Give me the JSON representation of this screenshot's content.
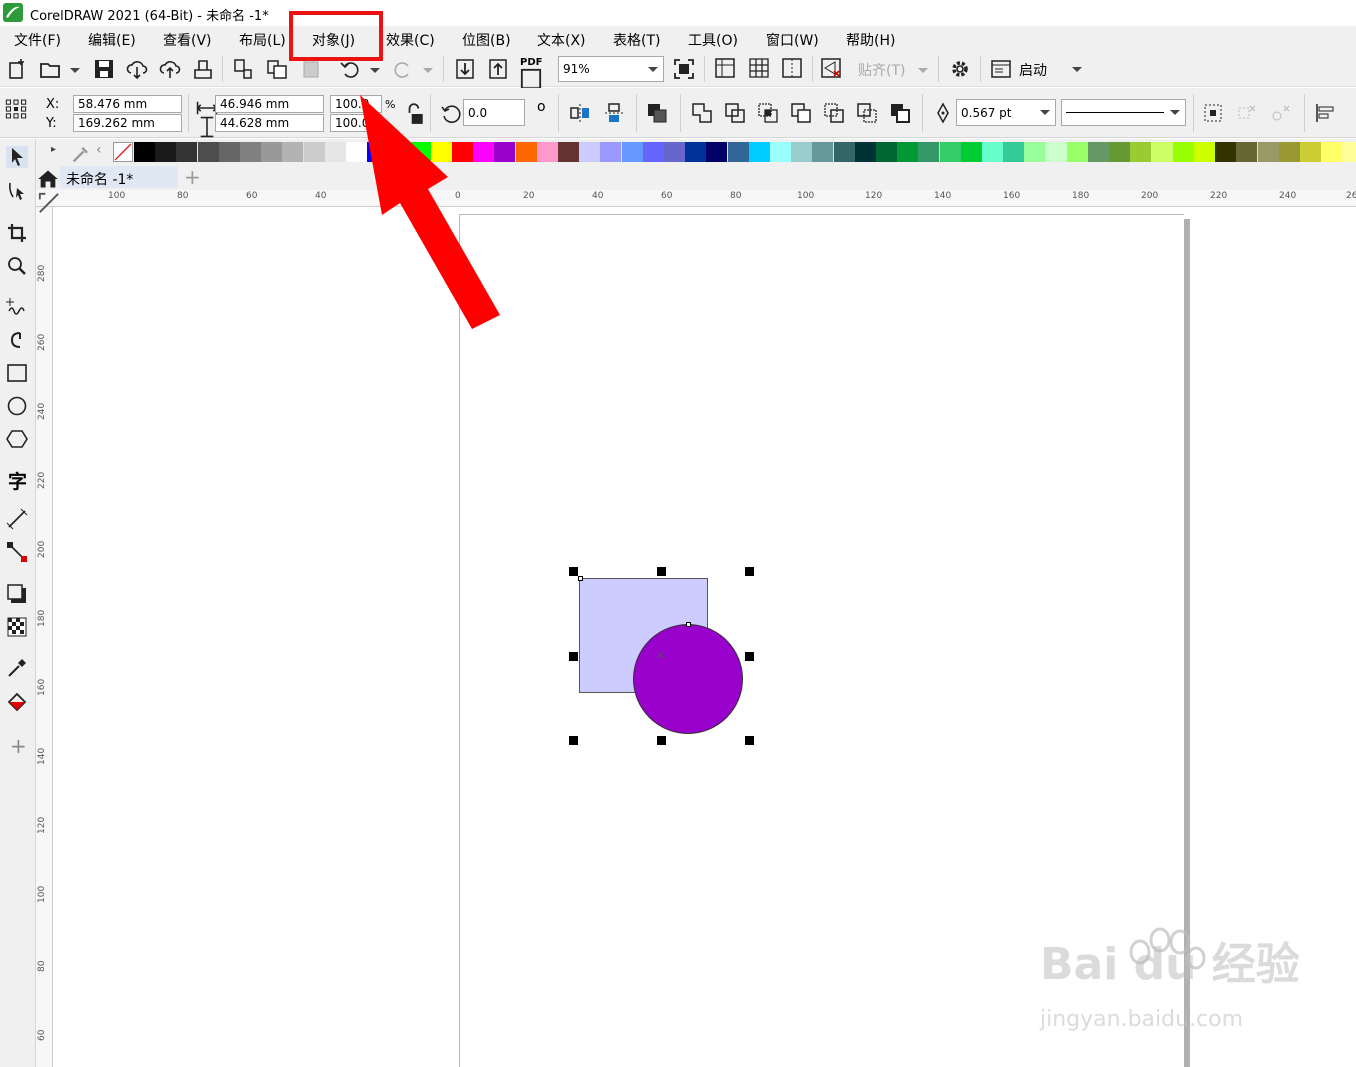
{
  "app": {
    "title": "CorelDRAW 2021 (64-Bit) - 未命名 -1*"
  },
  "menu": {
    "file": "文件(F)",
    "edit": "编辑(E)",
    "view": "查看(V)",
    "layout": "布局(L)",
    "object": "对象(J)",
    "effects": "效果(C)",
    "bitmaps": "位图(B)",
    "text": "文本(X)",
    "table": "表格(T)",
    "tools": "工具(O)",
    "window": "窗口(W)",
    "help": "帮助(H)"
  },
  "toolbar": {
    "pdf_label": "PDF",
    "zoom": "91%",
    "snap_label": "贴齐(T)",
    "launch_label": "启动"
  },
  "property_bar": {
    "x_label": "X:",
    "y_label": "Y:",
    "x_value": "58.476 mm",
    "y_value": "169.262 mm",
    "width_value": "46.946 mm",
    "height_value": "44.628 mm",
    "scale_x": "100.0",
    "scale_y": "100.0",
    "percent": "%",
    "rotation": "0.0",
    "degree": "o",
    "outline_width": "0.567 pt"
  },
  "document": {
    "tab_name": "未命名 -1*"
  },
  "rulers": {
    "horizontal": [
      "100",
      "80",
      "60",
      "40",
      "0",
      "20",
      "40",
      "60",
      "80",
      "100",
      "120",
      "140",
      "160",
      "180",
      "200",
      "220",
      "240",
      "26"
    ],
    "vertical": [
      "280",
      "260",
      "240",
      "220",
      "200",
      "180",
      "160",
      "140",
      "120",
      "100",
      "80",
      "60"
    ]
  },
  "palette": [
    "#000000",
    "#1a1a1a",
    "#333333",
    "#4d4d4d",
    "#666666",
    "#808080",
    "#999999",
    "#b3b3b3",
    "#cccccc",
    "#e6e6e6",
    "#ffffff",
    "#0000ff",
    "#00ffff",
    "#00ff00",
    "#ffff00",
    "#ff0000",
    "#ff00ff",
    "#9900cc",
    "#ff6600",
    "#ff99cc",
    "#663333",
    "#ccccff",
    "#9999ff",
    "#6699ff",
    "#6666ff",
    "#6666cc",
    "#003399",
    "#000066",
    "#336699",
    "#00ccff",
    "#99ffff",
    "#99cccc",
    "#669999",
    "#336666",
    "#003333",
    "#006633",
    "#009933",
    "#339966",
    "#33cc66",
    "#00cc33",
    "#66ffcc",
    "#33cc99",
    "#99ff99",
    "#ccffcc",
    "#99ff66",
    "#669966",
    "#669933",
    "#99cc33",
    "#ccff66",
    "#99ff00",
    "#ccff00",
    "#333300",
    "#666633",
    "#999966",
    "#999933",
    "#cccc33",
    "#ffff66",
    "#ffff99"
  ],
  "watermark": {
    "brand": "Bai du 经验",
    "url": "jingyan.baidu.com"
  },
  "colors": {
    "highlight": "#ee1111",
    "arrow": "#ff0000",
    "rect_fill": "#ccccff",
    "circle_fill": "#9900cc"
  }
}
